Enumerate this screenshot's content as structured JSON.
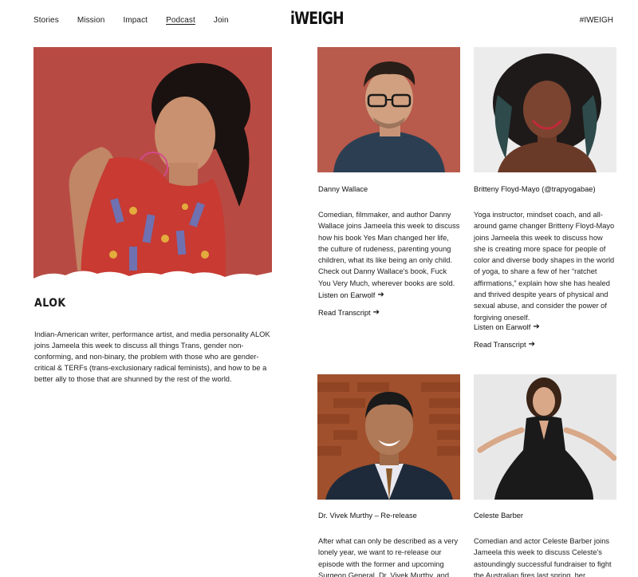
{
  "header": {
    "nav": [
      {
        "label": "Stories"
      },
      {
        "label": "Mission"
      },
      {
        "label": "Impact"
      },
      {
        "label": "Podcast",
        "active": true
      },
      {
        "label": "Join"
      }
    ],
    "logo": "iWEIGH",
    "hashtag": "#IWEIGH"
  },
  "featured": {
    "title": "ALOK",
    "description": "Indian-American writer, performance artist, and media personality ALOK joins Jameela this week to discuss all things Trans, gender non-conforming, and non-binary, the problem with those who are gender-critical & TERFs (trans-exclusionary radical feminists), and how to be a better ally to those that are shunned by the rest of the world."
  },
  "episodes": [
    {
      "name": "Danny Wallace",
      "description": "Comedian, filmmaker, and author Danny Wallace joins Jameela this week to discuss how his book Yes Man changed her life, the culture of rudeness, parenting young children, what its like being an only child. Check out Danny Wallace's book, Fuck You Very Much, wherever books are sold.",
      "listen_label": "Listen on Earwolf",
      "transcript_label": "Read Transcript"
    },
    {
      "name": "Britteny Floyd-Mayo (@trapyogabae)",
      "description": "Yoga instructor, mindset coach, and all-around game changer Britteny Floyd-Mayo joins Jameela this week to discuss how she is creating more space for people of color and diverse body shapes in the world of yoga, to share a few of her “ratchet affirmations,” explain how she has healed and thrived despite years of physical and sexual abuse, and consider the power of forgiving oneself.",
      "listen_label": "Listen on Earwolf",
      "transcript_label": "Read Transcript"
    },
    {
      "name": "Dr. Vivek Murthy – Re-release",
      "description": "After what can only be described as a very lonely year, we want to re-release our episode with the former and upcoming Surgeon General, Dr. Vivek Murthy, and"
    },
    {
      "name": "Celeste Barber",
      "description": "Comedian and actor Celeste Barber joins Jameela this week to discuss Celeste's astoundingly successful fundraiser to fight the Australian fires last spring, her"
    }
  ],
  "colors": {
    "alok_bg": "#b84a44",
    "danny_bg": "#b85a4c",
    "britteny_bg": "#ececec",
    "vivek_bg": "#a0502c",
    "celeste_bg": "#e8e8e8"
  }
}
